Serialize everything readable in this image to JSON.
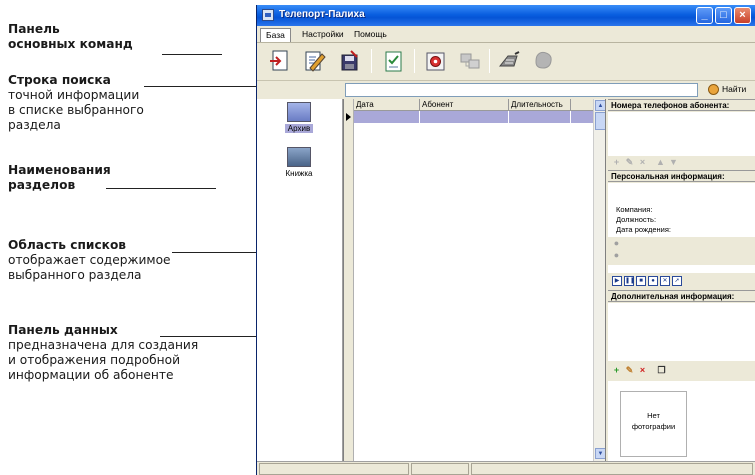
{
  "annotations": [
    {
      "title": "Панель",
      "title2": "основных команд",
      "desc": []
    },
    {
      "title": "Строка поиска",
      "title2": "",
      "desc": [
        "точной информации",
        "в списке выбранного",
        "раздела"
      ]
    },
    {
      "title": "Наименования",
      "title2": "разделов",
      "desc": []
    },
    {
      "title": "Область списков",
      "title2": "",
      "desc": [
        "отображает содержимое",
        "выбранного раздела"
      ]
    },
    {
      "title": "Панель данных",
      "title2": "",
      "desc": [
        "предназначена для создания",
        "и отображения подробной",
        "информации об абоненте"
      ]
    }
  ],
  "window": {
    "title": "Телепорт-Палиха",
    "minimize": "_",
    "maximize": "□",
    "close": "×"
  },
  "menu": [
    {
      "label": "База",
      "active": true
    },
    {
      "label": "Настройки",
      "active": false
    },
    {
      "label": "Помощь",
      "active": false
    }
  ],
  "toolbar_icons": [
    "import-icon",
    "edit-note-icon",
    "save-disk-icon",
    "checklist-icon",
    "dial-icon",
    "network-icon",
    "phone-icon",
    "blob-icon"
  ],
  "search": {
    "value": "",
    "find_label": "Найти"
  },
  "sections": [
    {
      "label": "Архив",
      "active": true
    },
    {
      "label": "Книжка",
      "active": false
    }
  ],
  "list": {
    "columns": [
      "Дата",
      "Абонент",
      "Длительность"
    ]
  },
  "data_panel": {
    "phones_header": "Номера телефонов абонента:",
    "personal_header": "Персональная информация:",
    "company_label": "Компания:",
    "position_label": "Должность:",
    "birthdate_label": "Дата рождения:",
    "extra_header": "Дополнительная информация:",
    "photo_line1": "Нет",
    "photo_line2": "фотографии"
  },
  "colors": {
    "titlebar": "#0554d6",
    "selection": "#a9a8d8",
    "window_bg": "#ece9d8",
    "add_green": "#2a9a2a",
    "delete_red": "#d02020"
  }
}
